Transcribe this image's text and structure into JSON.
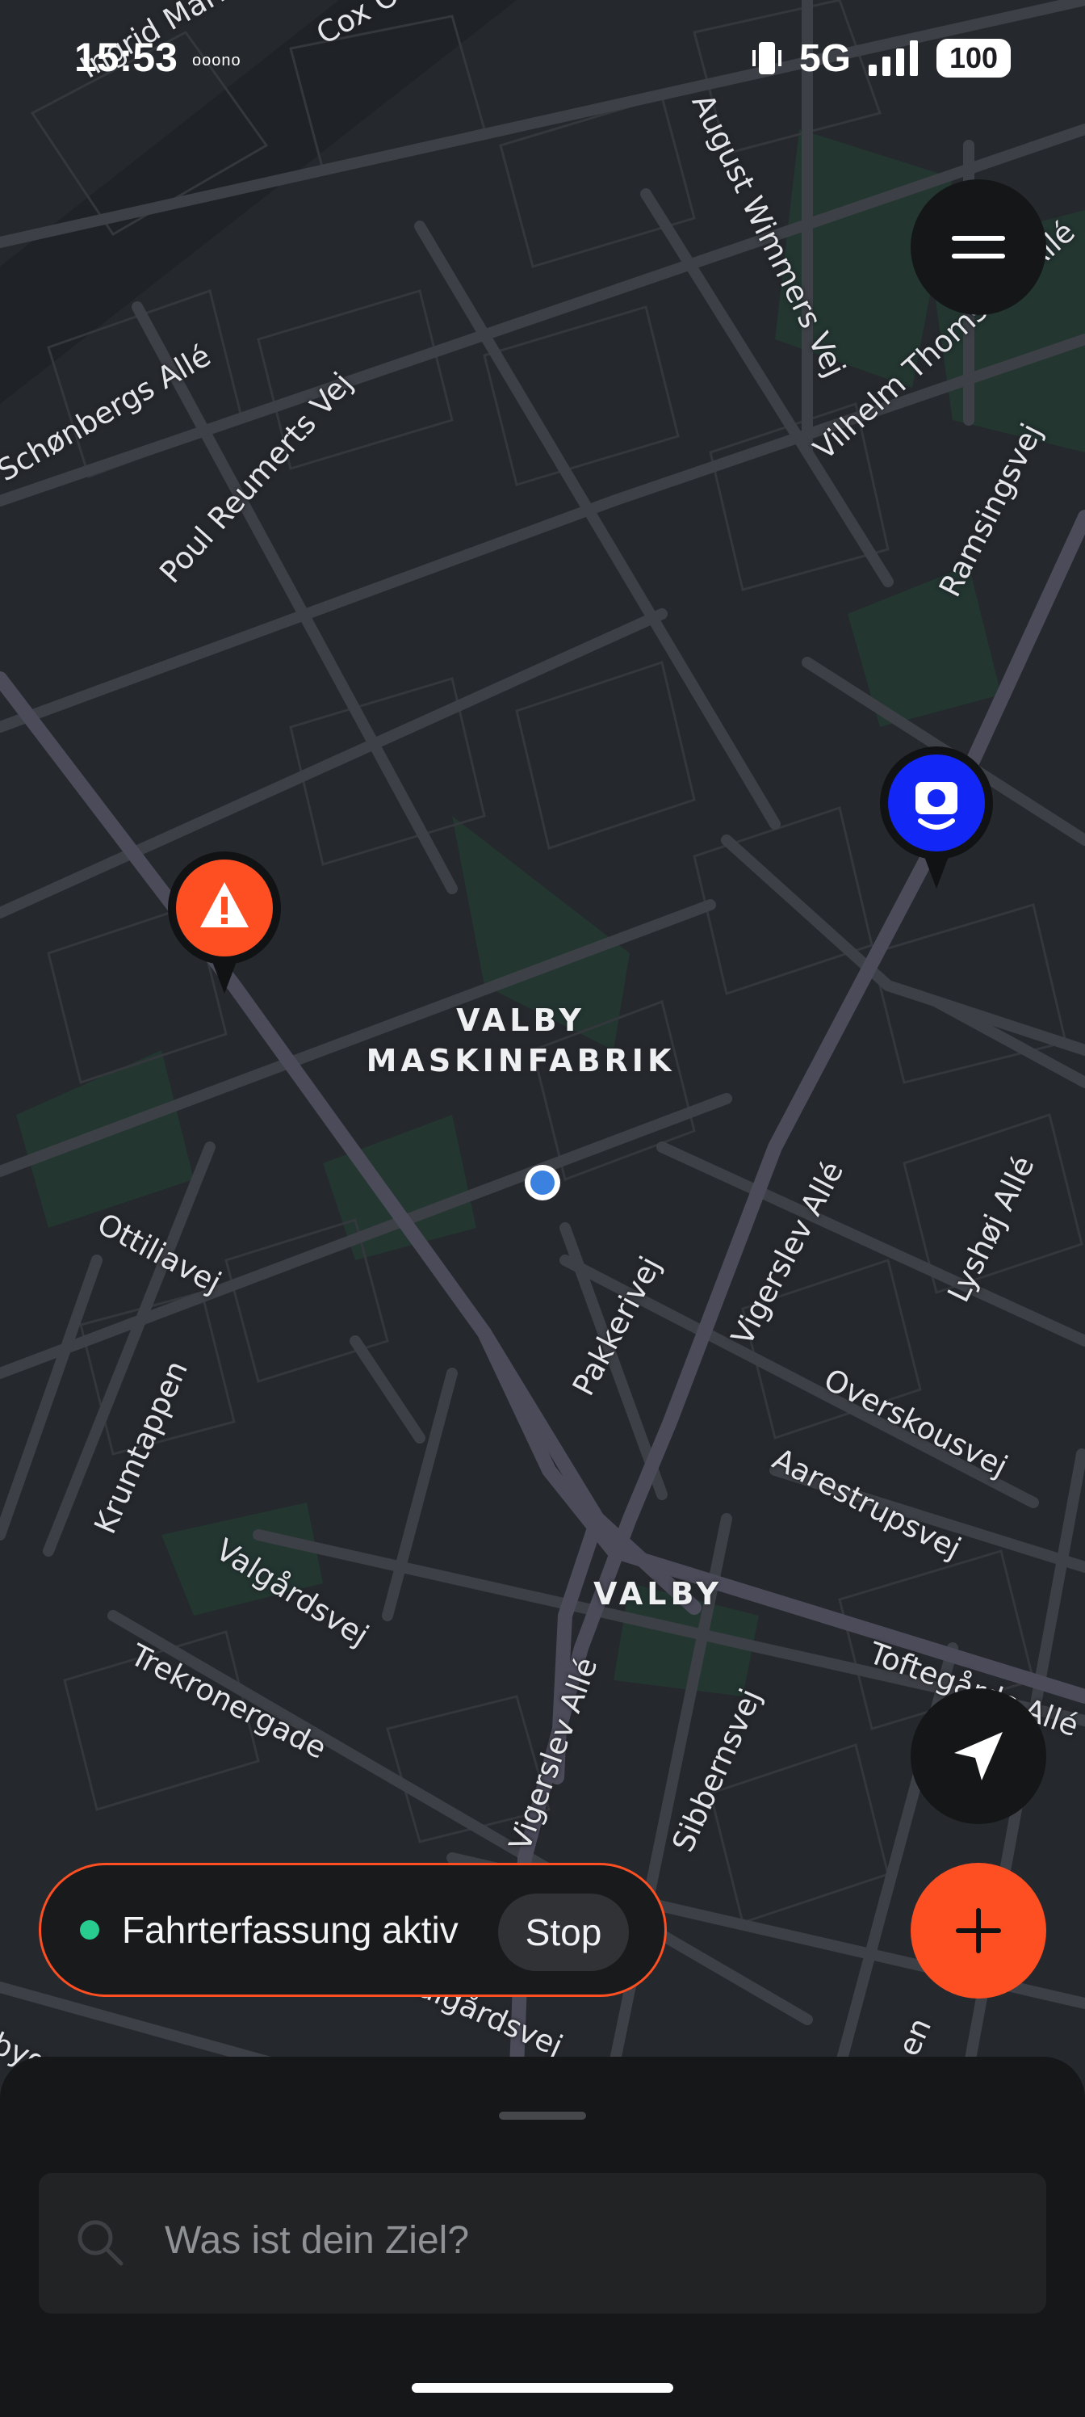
{
  "status_bar": {
    "time": "15:53",
    "notification_icons": "ooono",
    "network": "5G",
    "battery": "100",
    "icons": [
      "vibrate-icon",
      "signal-bars-icon",
      "battery-icon"
    ]
  },
  "map": {
    "theme_colors": {
      "background": "#25282c",
      "roads": "#3d4046",
      "arterial": "#4b4b5a",
      "parks": "#233630"
    },
    "place_labels": {
      "valby_maskinfabrik_line1": "VALBY",
      "valby_maskinfabrik_line2": "MASKINFABRIK",
      "valby": "VALBY"
    },
    "street_labels": {
      "ingrid_marie": "Ingrid Marie",
      "cox": "Cox O",
      "august_wimmers": "August Wimmers Vej",
      "vilhelm_thomsen": "Vilhelm Thomsens Allé",
      "schonbergs": "Schønbergs Allé",
      "poul_reumerts": "Poul Reumerts Vej",
      "ramsingsvej": "Ramsingsvej",
      "ottiliavej": "Ottiliavej",
      "krumtappen": "Krumtappen",
      "pakkerivej": "Pakkerivej",
      "vigerslev_alle_upper": "Vigerslev Allé",
      "lyshoj_alle": "Lyshøj Allé",
      "overskousvej": "Overskousvej",
      "aarestrupsvej": "Aarestrupsvej",
      "valgardsvej_upper": "Valgårdsvej",
      "trekronergade": "Trekronergade",
      "toftegards_alle": "Toftegårds Allé",
      "vigerslev_alle_lower": "Vigerslev Allé",
      "sibbernsvej": "Sibbernsvej",
      "valgardsvej_lower": "Valgårdsvej",
      "edge_left": "byg",
      "edge_right": "en"
    },
    "markers": {
      "hazard": {
        "icon": "warning-triangle-icon",
        "color": "#fd4f22"
      },
      "speed_camera": {
        "icon": "speed-camera-icon",
        "color": "#1227f5"
      },
      "current_location": {
        "icon": "location-dot-icon",
        "color": "#3b82e0"
      }
    }
  },
  "controls": {
    "menu": {
      "icon": "hamburger-menu-icon"
    },
    "recenter": {
      "icon": "navigation-arrow-icon"
    },
    "add": {
      "icon": "plus-icon",
      "color": "#fd4f22"
    }
  },
  "trip_recording": {
    "status_text": "Fahrterfassung aktiv",
    "stop_label": "Stop",
    "active_color": "#27cc8e"
  },
  "search": {
    "placeholder": "Was ist dein Ziel?",
    "icon": "search-icon"
  }
}
